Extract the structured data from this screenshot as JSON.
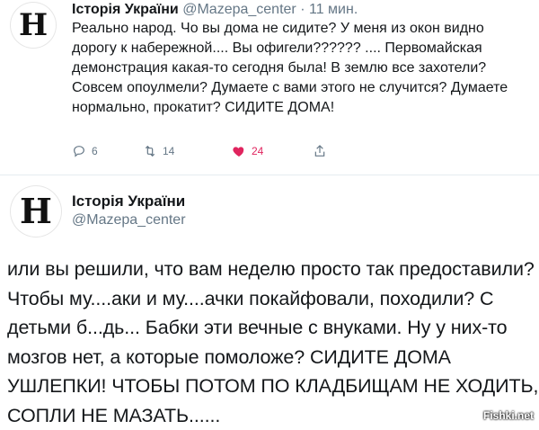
{
  "tweet1": {
    "name": "Історія України",
    "handle": "@Mazepa_center",
    "separator": "·",
    "time": "11 мин.",
    "avatar_letter": "Н",
    "text": "Реально народ. Чо вы дома не сидите? У меня из окон видно дорогу к набережной.... Вы офигели?????? .... Первомайская демонстрация какая-то сегодня была! В землю все захотели? Совсем опоулмели? Думаете с вами этого не случится? Думаете нормально, прокатит? СИДИТЕ ДОМА!",
    "replies": "6",
    "retweets": "14",
    "likes": "24",
    "like_color": "#e0245e"
  },
  "tweet2": {
    "name": "Історія України",
    "handle": "@Mazepa_center",
    "avatar_letter": "Н",
    "text": "или вы решили, что вам неделю просто так предоставили? Чтобы му....аки и му....ачки покайфовали, походили? С детьми б...дь... Бабки эти вечные с внуками. Ну у них-то мозгов нет, а которые помоложе? СИДИТЕ ДОМА УШЛЕПКИ! ЧТОБЫ ПОТОМ ПО КЛАДБИЩАМ НЕ ХОДИТЬ, СОПЛИ НЕ МАЗАТЬ......"
  },
  "watermark": "Fishki.net"
}
